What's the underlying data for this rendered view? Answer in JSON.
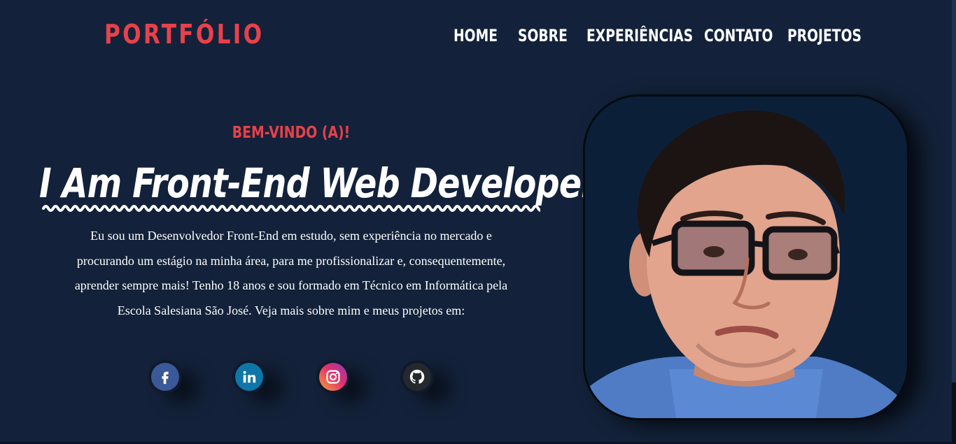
{
  "header": {
    "logo": "PORTFÓLIO",
    "nav": [
      {
        "label": "HOME"
      },
      {
        "label": "SOBRE"
      },
      {
        "label": "EXPERIÊNCIAS"
      },
      {
        "label": "CONTATO"
      },
      {
        "label": "PROJETOS"
      }
    ]
  },
  "hero": {
    "welcome": "BEM-VINDO (A)!",
    "headline": "I Am Front-End Web Developer",
    "description": "Eu sou um Desenvolvedor Front-End em estudo, sem experiência no mercado e procurando um estágio na minha área, para me profissionalizar e, consequentemente, aprender sempre mais! Tenho 18 anos e sou formado em Técnico em Informática pela Escola Salesiana São José. Veja mais sobre mim e meus projetos em:"
  },
  "social": [
    {
      "name": "facebook",
      "icon": "facebook-icon",
      "color": "#3b5998"
    },
    {
      "name": "linkedin",
      "icon": "linkedin-icon",
      "color": "#0e76a8"
    },
    {
      "name": "instagram",
      "icon": "instagram-icon",
      "color": "#e1306c"
    },
    {
      "name": "github",
      "icon": "github-icon",
      "color": "#24292e"
    }
  ],
  "colors": {
    "background": "#13223a",
    "accent": "#e8414a",
    "text": "#ffffff"
  }
}
